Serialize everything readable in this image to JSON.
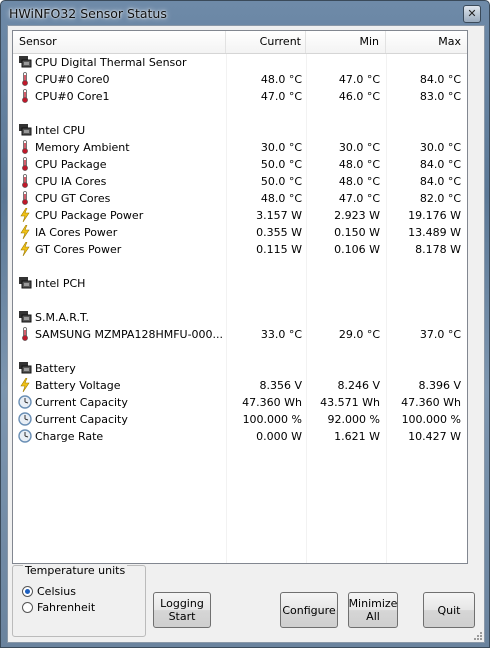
{
  "window": {
    "title": "HWiNFO32 Sensor Status"
  },
  "columns": {
    "sensor": "Sensor",
    "current": "Current",
    "min": "Min",
    "max": "Max"
  },
  "rows": [
    {
      "type": "group",
      "label": "CPU Digital Thermal Sensor",
      "icon": "chip-icon"
    },
    {
      "type": "sensor",
      "label": "CPU#0 Core0",
      "current": "48.0 °C",
      "min": "47.0 °C",
      "max": "84.0 °C",
      "icon": "thermometer-icon"
    },
    {
      "type": "sensor",
      "label": "CPU#0 Core1",
      "current": "47.0 °C",
      "min": "46.0 °C",
      "max": "83.0 °C",
      "icon": "thermometer-icon"
    },
    {
      "type": "blank"
    },
    {
      "type": "group",
      "label": "Intel CPU",
      "icon": "chip-icon"
    },
    {
      "type": "sensor",
      "label": "Memory Ambient",
      "current": "30.0 °C",
      "min": "30.0 °C",
      "max": "30.0 °C",
      "icon": "thermometer-icon"
    },
    {
      "type": "sensor",
      "label": "CPU Package",
      "current": "50.0 °C",
      "min": "48.0 °C",
      "max": "84.0 °C",
      "icon": "thermometer-icon"
    },
    {
      "type": "sensor",
      "label": "CPU IA Cores",
      "current": "50.0 °C",
      "min": "48.0 °C",
      "max": "84.0 °C",
      "icon": "thermometer-icon"
    },
    {
      "type": "sensor",
      "label": "CPU GT Cores",
      "current": "48.0 °C",
      "min": "47.0 °C",
      "max": "82.0 °C",
      "icon": "thermometer-icon"
    },
    {
      "type": "sensor",
      "label": "CPU Package Power",
      "current": "3.157 W",
      "min": "2.923 W",
      "max": "19.176 W",
      "icon": "lightning-icon"
    },
    {
      "type": "sensor",
      "label": "IA Cores Power",
      "current": "0.355 W",
      "min": "0.150 W",
      "max": "13.489 W",
      "icon": "lightning-icon"
    },
    {
      "type": "sensor",
      "label": "GT Cores Power",
      "current": "0.115 W",
      "min": "0.106 W",
      "max": "8.178 W",
      "icon": "lightning-icon"
    },
    {
      "type": "blank"
    },
    {
      "type": "group",
      "label": "Intel PCH",
      "icon": "chip-icon"
    },
    {
      "type": "blank"
    },
    {
      "type": "group",
      "label": "S.M.A.R.T.",
      "icon": "chip-icon"
    },
    {
      "type": "sensor",
      "label": "SAMSUNG MZMPA128HMFU-000...",
      "current": "33.0 °C",
      "min": "29.0 °C",
      "max": "37.0 °C",
      "icon": "thermometer-icon"
    },
    {
      "type": "blank"
    },
    {
      "type": "group",
      "label": "Battery",
      "icon": "chip-icon"
    },
    {
      "type": "sensor",
      "label": "Battery Voltage",
      "current": "8.356 V",
      "min": "8.246 V",
      "max": "8.396 V",
      "icon": "lightning-icon"
    },
    {
      "type": "sensor",
      "label": "Current Capacity",
      "current": "47.360 Wh",
      "min": "43.571 Wh",
      "max": "47.360 Wh",
      "icon": "clock-icon"
    },
    {
      "type": "sensor",
      "label": "Current Capacity",
      "current": "100.000 %",
      "min": "92.000 %",
      "max": "100.000 %",
      "icon": "clock-icon"
    },
    {
      "type": "sensor",
      "label": "Charge Rate",
      "current": "0.000 W",
      "min": "1.621 W",
      "max": "10.427 W",
      "icon": "clock-icon"
    }
  ],
  "temperature_units": {
    "title": "Temperature units",
    "options": [
      {
        "label": "Celsius",
        "selected": true
      },
      {
        "label": "Fahrenheit",
        "selected": false
      }
    ]
  },
  "buttons": {
    "logging_start": [
      "Logging",
      "Start"
    ],
    "configure": "Configure",
    "minimize_all": [
      "Minimize",
      "All"
    ],
    "quit": "Quit"
  },
  "colors": {
    "thermometer": "#c0182a",
    "lightning": "#f2c318",
    "clock": "#6a8fb5"
  }
}
